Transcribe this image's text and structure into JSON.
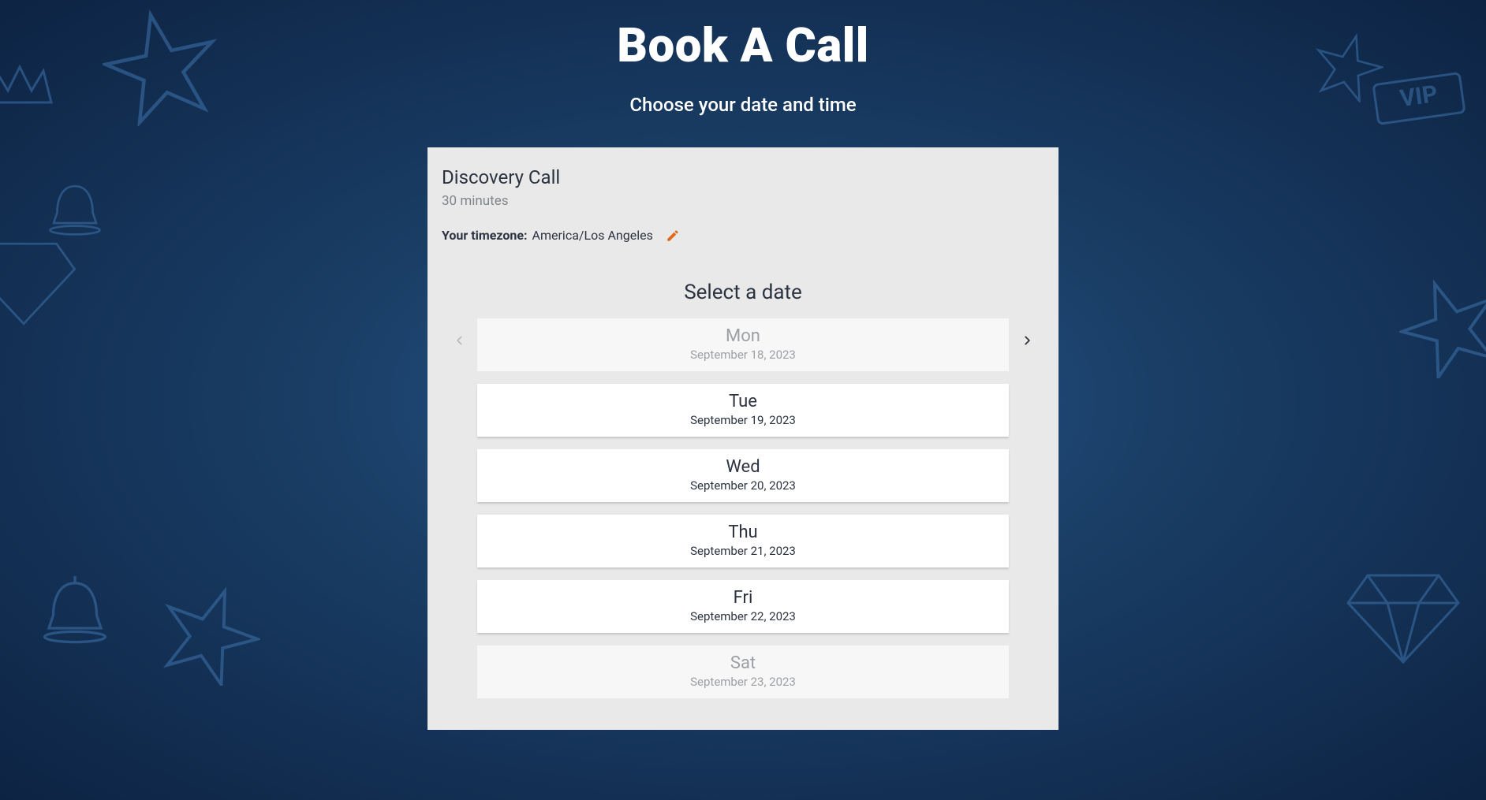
{
  "header": {
    "title": "Book A Call",
    "subtitle": "Choose your date and time"
  },
  "call": {
    "name": "Discovery Call",
    "duration": "30 minutes"
  },
  "timezone": {
    "label": "Your timezone:",
    "value": "America/Los Angeles"
  },
  "selectDateLabel": "Select a date",
  "dates": [
    {
      "day": "Mon",
      "full": "September 18, 2023",
      "enabled": false
    },
    {
      "day": "Tue",
      "full": "September 19, 2023",
      "enabled": true
    },
    {
      "day": "Wed",
      "full": "September 20, 2023",
      "enabled": true
    },
    {
      "day": "Thu",
      "full": "September 21, 2023",
      "enabled": true
    },
    {
      "day": "Fri",
      "full": "September 22, 2023",
      "enabled": true
    },
    {
      "day": "Sat",
      "full": "September 23, 2023",
      "enabled": false
    }
  ],
  "nav": {
    "prevEnabled": false,
    "nextEnabled": true
  },
  "colors": {
    "accent": "#e06a1a"
  }
}
